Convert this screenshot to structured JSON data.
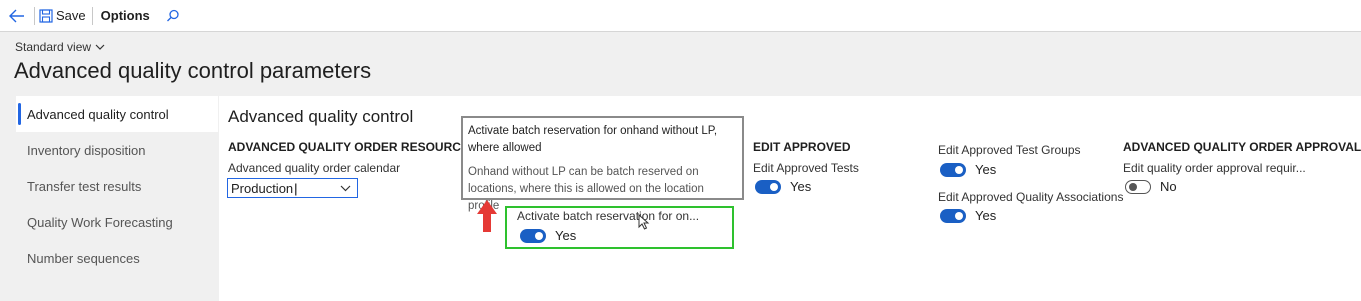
{
  "toolbar": {
    "save_label": "Save",
    "options_label": "Options"
  },
  "view": {
    "label": "Standard view"
  },
  "page": {
    "title": "Advanced quality control parameters"
  },
  "nav": {
    "items": [
      {
        "label": "Advanced quality control"
      },
      {
        "label": "Inventory disposition"
      },
      {
        "label": "Transfer test results"
      },
      {
        "label": "Quality Work Forecasting"
      },
      {
        "label": "Number sequences"
      }
    ]
  },
  "section": {
    "title": "Advanced quality control",
    "resource_group": {
      "heading": "ADVANCED QUALITY ORDER RESOURCE ALL",
      "calendar_label": "Advanced quality order calendar",
      "calendar_value": "Production"
    },
    "batch_reservation": {
      "label": "Activate batch reservation for on...",
      "value": "Yes"
    },
    "edit_approved": {
      "heading": "EDIT APPROVED",
      "tests_label": "Edit Approved Tests",
      "tests_value": "Yes",
      "test_groups_label": "Edit Approved Test Groups",
      "test_groups_value": "Yes",
      "quality_assoc_label": "Edit Approved Quality Associations",
      "quality_assoc_value": "Yes"
    },
    "approval": {
      "heading": "ADVANCED QUALITY ORDER APPROVAL",
      "label": "Edit quality order approval requir...",
      "value": "No"
    }
  },
  "tooltip": {
    "title": "Activate batch reservation for onhand without LP, where allowed",
    "body": "Onhand without LP can be batch reserved on locations, where this is allowed on the location profile"
  },
  "colors": {
    "accent": "#2266e3",
    "toggle_on": "#1a5fc4",
    "highlight_box": "#2ec12e",
    "annotation_arrow": "#e53935"
  }
}
